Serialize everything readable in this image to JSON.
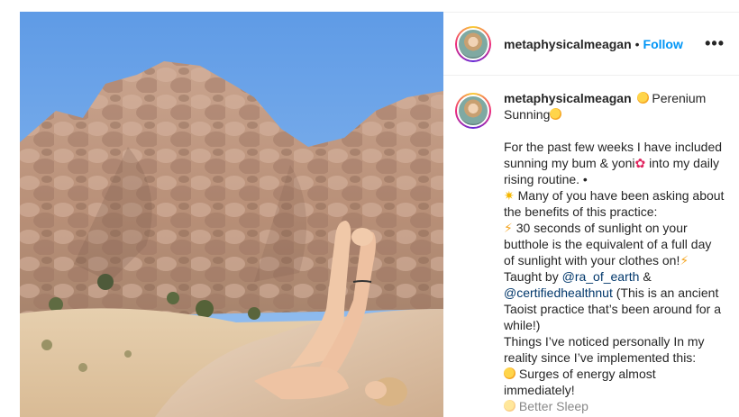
{
  "post": {
    "image_alt": "",
    "author": "metaphysicalmeagan",
    "separator": "•",
    "follow_label": "Follow",
    "more_label": "•••"
  },
  "caption": {
    "author": "metaphysicalmeagan",
    "lines": [
      {
        "type": "title1",
        "text": "Perenium"
      },
      {
        "type": "title2",
        "text": "Sunning"
      },
      {
        "type": "text",
        "text": "For the past few weeks I have included"
      },
      {
        "type": "text2",
        "before": "sunning my bum & yoni",
        "after": " into my daily"
      },
      {
        "type": "text",
        "text": "rising routine. •"
      },
      {
        "type": "star",
        "text": " Many of you have been asking about"
      },
      {
        "type": "text",
        "text": "the benefits of this practice:"
      },
      {
        "type": "bolt",
        "text": " 30 seconds of sunlight on your"
      },
      {
        "type": "text",
        "text": "butthole is the equivalent of a full day"
      },
      {
        "type": "boltend",
        "text": "of sunlight with your clothes on!"
      },
      {
        "type": "mention1",
        "before": "Taught by ",
        "mention": "@ra_of_earth",
        "after": " &"
      },
      {
        "type": "mention2",
        "mention": "@certifiedhealthnut",
        "after": " (This is an ancient"
      },
      {
        "type": "text",
        "text": "Taoist practice that’s been around for a"
      },
      {
        "type": "text",
        "text": "while!)"
      },
      {
        "type": "text",
        "text": "Things I’ve noticed personally In my"
      },
      {
        "type": "text",
        "text": "reality since I’ve implemented this:"
      },
      {
        "type": "sun",
        "text": " Surges of energy almost"
      },
      {
        "type": "text",
        "text": "immediately!"
      },
      {
        "type": "sunfaded",
        "text": " Better Sleep"
      }
    ]
  },
  "icons": {
    "star": "star-emoji-icon",
    "bolt": "lightning-emoji-icon",
    "sun": "smiley-emoji-icon",
    "flower": "hibiscus-emoji-icon"
  },
  "colors": {
    "follow": "#0095f6",
    "mention": "#00376b",
    "text": "#262626",
    "border": "#efefef"
  }
}
